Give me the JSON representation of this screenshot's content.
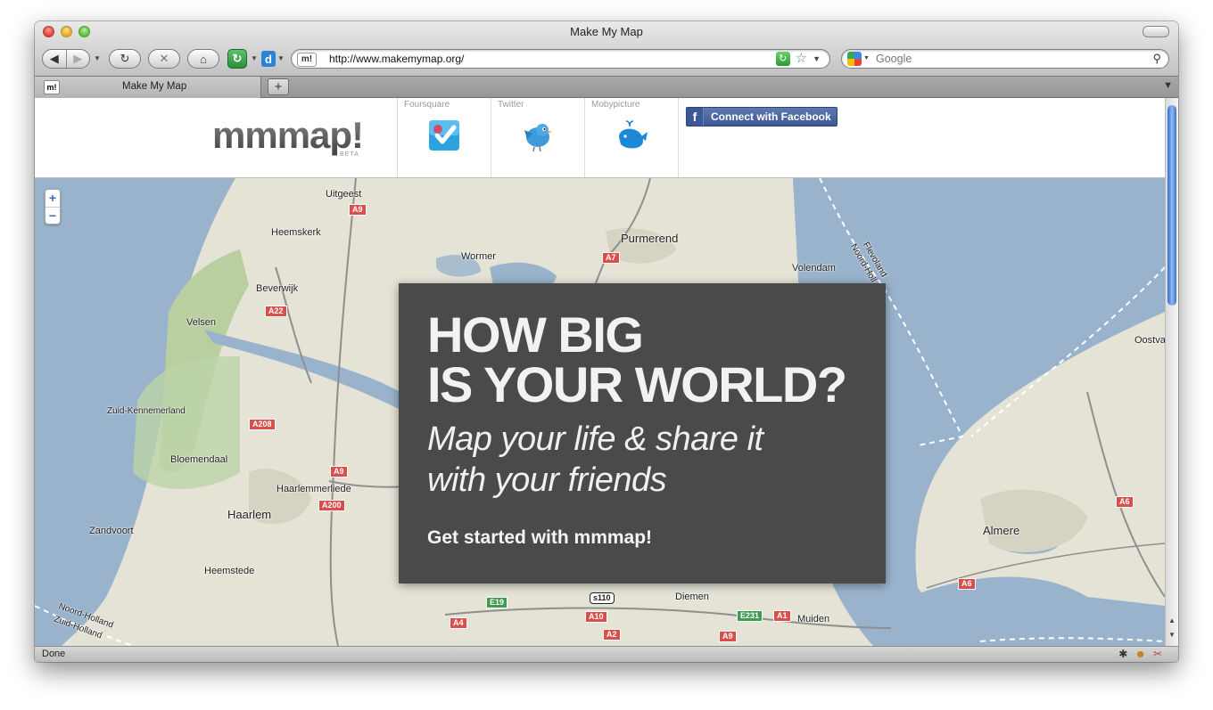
{
  "window": {
    "title": "Make My Map"
  },
  "toolbar": {
    "url": "http://www.makemymap.org/",
    "favicon_text": "m!",
    "search_placeholder": "Google",
    "ext2_text": "d"
  },
  "tabs": [
    {
      "label": "Make My Map",
      "favicon_text": "m!"
    }
  ],
  "site": {
    "logo": "mmmap!",
    "beta": "BETA",
    "services": [
      {
        "label": "Foursquare",
        "icon": "foursquare-icon"
      },
      {
        "label": "Twitter",
        "icon": "twitter-bird-icon"
      },
      {
        "label": "Mobypicture",
        "icon": "whale-icon"
      }
    ],
    "facebook_button": "Connect with Facebook"
  },
  "hero": {
    "headline": "HOW BIG\nIS YOUR WORLD?",
    "subline": "Map your life & share it\nwith your friends",
    "cta": "Get started with mmmap!"
  },
  "map": {
    "zoom_in": "+",
    "zoom_out": "−",
    "places": [
      "Uitgeest",
      "Heemskerk",
      "Purmerend",
      "Wormer",
      "Volendam",
      "Beverwijk",
      "Velsen",
      "Oostva",
      "Zuid-Kennemerland",
      "Bloemendaal",
      "Haarlemmerliede",
      "Haarlem",
      "Zandvoort",
      "Heemstede",
      "Almere",
      "Diemen",
      "Muiden",
      "Noord-Holland",
      "Zuid-Holland",
      "Flevoland",
      "Noord-Holl"
    ],
    "roads": [
      "A9",
      "A7",
      "A22",
      "A208",
      "A9",
      "A200",
      "A4",
      "A10",
      "A2",
      "E19",
      "s110",
      "E231",
      "A1",
      "A9",
      "A6",
      "A6"
    ]
  },
  "status": {
    "text": "Done"
  },
  "colors": {
    "overlay": "#4a4a4a",
    "facebook": "#3b5998",
    "water": "#9eb6d6",
    "land": "#e4e3d6"
  }
}
